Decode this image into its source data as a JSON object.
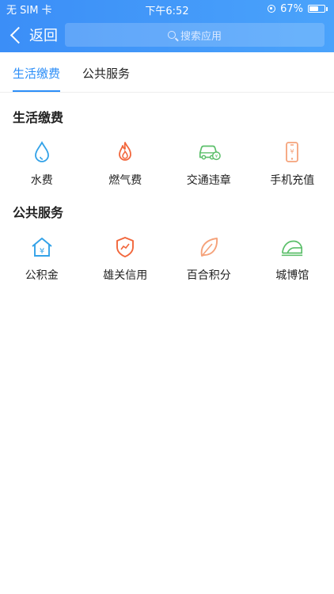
{
  "status": {
    "carrier": "无 SIM 卡",
    "time": "下午6:52",
    "battery": "67%",
    "battery_level": 0.67
  },
  "nav": {
    "back_label": "返回",
    "search_placeholder": "搜索应用"
  },
  "tabs": [
    {
      "label": "生活缴费",
      "active": true
    },
    {
      "label": "公共服务",
      "active": false
    }
  ],
  "sections": [
    {
      "title": "生活缴费",
      "items": [
        {
          "label": "水费",
          "icon": "water-drop-icon"
        },
        {
          "label": "燃气费",
          "icon": "flame-icon"
        },
        {
          "label": "交通违章",
          "icon": "car-icon"
        },
        {
          "label": "手机充值",
          "icon": "phone-icon"
        }
      ]
    },
    {
      "title": "公共服务",
      "items": [
        {
          "label": "公积金",
          "icon": "house-icon"
        },
        {
          "label": "雄关信用",
          "icon": "shield-icon"
        },
        {
          "label": "百合积分",
          "icon": "leaf-icon"
        },
        {
          "label": "城博馆",
          "icon": "museum-icon"
        }
      ]
    }
  ],
  "colors": {
    "primary": "#2c8ef8",
    "blue_icon": "#33a2e8",
    "red_icon": "#f2663b",
    "green_icon": "#5bbf6a",
    "orange_icon": "#f5a27a"
  }
}
